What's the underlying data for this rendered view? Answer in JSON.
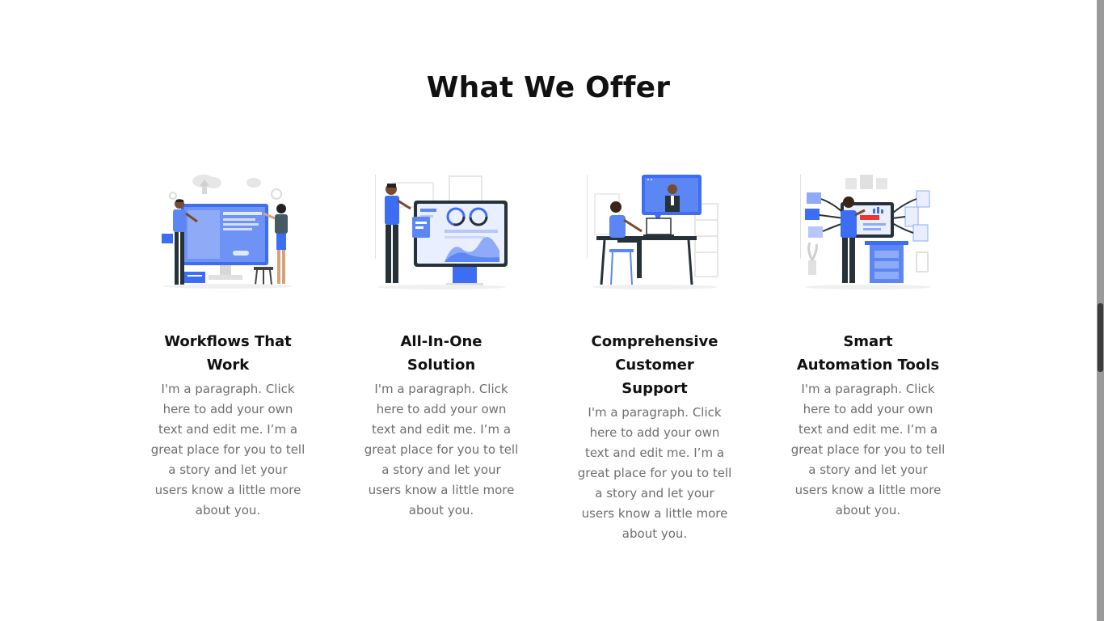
{
  "section": {
    "title": "What We Offer"
  },
  "cards": [
    {
      "title": "Workflows That Work",
      "text": "I'm a paragraph. Click here to add your own text and edit me. I’m a great place for you to tell a story and let your users know a little more about you."
    },
    {
      "title": "All-In-One Solution",
      "text": "I'm a paragraph. Click here to add your own text and edit me. I’m a great place for you to tell a story and let your users know a little more about you."
    },
    {
      "title": "Comprehensive Customer Support",
      "text": "I'm a paragraph. Click here to add your own text and edit me. I’m a great place for you to tell a story and let your users know a little more about you."
    },
    {
      "title": "Smart Automation Tools",
      "text": "I'm a paragraph. Click here to add your own text and edit me. I’m a great place for you to tell a story and let your users know a little more about you."
    }
  ],
  "icons": [
    "team-dashboard-illustration",
    "analytics-monitor-illustration",
    "video-call-support-illustration",
    "automation-workflow-illustration"
  ],
  "colors": {
    "accent": "#4A7CF7",
    "heading": "#111111",
    "body_text": "#6E6E6E",
    "illustration_dark": "#263238",
    "illustration_light": "#E8E8E8"
  }
}
